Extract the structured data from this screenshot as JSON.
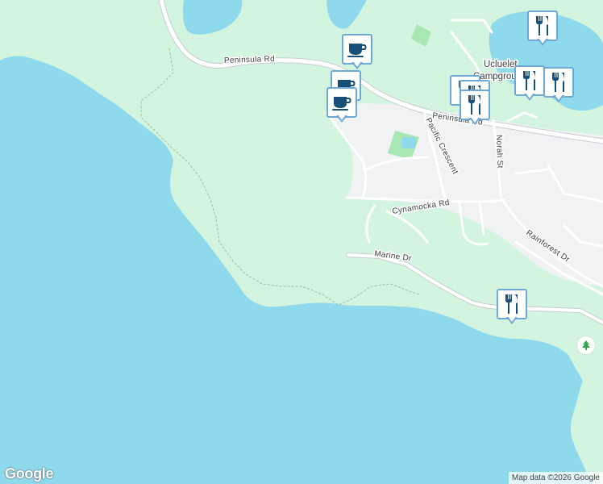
{
  "map": {
    "roads": [
      {
        "id": "peninsula-rd-west",
        "label": "Peninsula Rd"
      },
      {
        "id": "peninsula-rd-east",
        "label": "Peninsula Rd"
      },
      {
        "id": "pacific-crescent",
        "label": "Pacific Crescent"
      },
      {
        "id": "norah-st",
        "label": "Norah St"
      },
      {
        "id": "cynamocka-rd",
        "label": "Cynamocka Rd"
      },
      {
        "id": "marine-dr",
        "label": "Marine Dr"
      },
      {
        "id": "rainforest-dr",
        "label": "Rainforest Dr"
      }
    ],
    "places": [
      {
        "id": "ucluelet-campground",
        "line1": "Ucluelet",
        "line2": "Campground"
      }
    ],
    "markers": [
      {
        "type": "cafe",
        "icon": "coffee-cup-icon"
      },
      {
        "type": "cafe",
        "icon": "coffee-cup-icon"
      },
      {
        "type": "cafe",
        "icon": "coffee-cup-icon"
      },
      {
        "type": "restaurant",
        "icon": "fork-knife-icon"
      },
      {
        "type": "restaurant",
        "icon": "fork-knife-icon"
      },
      {
        "type": "restaurant",
        "icon": "fork-knife-icon"
      },
      {
        "type": "restaurant",
        "icon": "fork-knife-icon"
      },
      {
        "type": "restaurant",
        "icon": "fork-knife-icon"
      },
      {
        "type": "restaurant",
        "icon": "fork-knife-icon"
      },
      {
        "type": "restaurant",
        "icon": "fork-knife-icon"
      }
    ],
    "park_icon": "tree-icon",
    "colors": {
      "water": "#8fd9ec",
      "land": "#d3f5df",
      "urban": "#f1f2f4",
      "park": "#a8e6b4",
      "road": "#ffffff",
      "marker_border": "#6ea8d6",
      "marker_icon": "#164f78"
    }
  },
  "branding": {
    "logo": "Google",
    "attribution": "Map data ©2026 Google"
  }
}
